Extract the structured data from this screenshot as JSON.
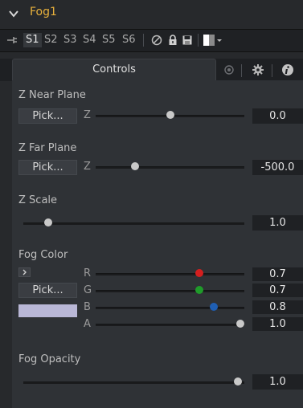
{
  "tool": {
    "title": "Fog1"
  },
  "versions": [
    {
      "label": "S1",
      "active": true
    },
    {
      "label": "S2",
      "active": false
    },
    {
      "label": "S3",
      "active": false
    },
    {
      "label": "S4",
      "active": false
    },
    {
      "label": "S5",
      "active": false
    },
    {
      "label": "S6",
      "active": false
    }
  ],
  "tabs": {
    "controls": "Controls"
  },
  "controls": {
    "z_near": {
      "label": "Z Near Plane",
      "pick": "Pick...",
      "axis": "Z",
      "value": "0.0",
      "slider_fraction": 0.51
    },
    "z_far": {
      "label": "Z Far Plane",
      "pick": "Pick...",
      "axis": "Z",
      "value": "-500.0",
      "slider_fraction": 0.27
    },
    "z_scale": {
      "label": "Z Scale",
      "value": "1.0",
      "slider_fraction": 0.11
    },
    "fog_color": {
      "label": "Fog Color",
      "pick": "Pick...",
      "swatch_color": "#b9b7d6",
      "channels": [
        {
          "axis": "R",
          "value": "0.7",
          "slider_fraction": 0.7,
          "knob_color": "#d41f1f"
        },
        {
          "axis": "G",
          "value": "0.7",
          "slider_fraction": 0.7,
          "knob_color": "#1f9b2a"
        },
        {
          "axis": "B",
          "value": "0.8",
          "slider_fraction": 0.8,
          "knob_color": "#1f5fb4"
        },
        {
          "axis": "A",
          "value": "1.0",
          "slider_fraction": 1.0,
          "knob_color": "#c9c9c9"
        }
      ]
    },
    "fog_opacity": {
      "label": "Fog Opacity",
      "value": "1.0",
      "slider_fraction": 1.0
    }
  },
  "colors": {
    "title": "#e8b13c",
    "panel_bg": "#2f3236"
  },
  "icons": [
    "chevron-down-icon",
    "pin-icon",
    "reset-icon",
    "lock-icon",
    "save-icon",
    "color-dropdown-icon",
    "settings-tab-icon",
    "gear-tab-icon",
    "info-tab-icon"
  ]
}
